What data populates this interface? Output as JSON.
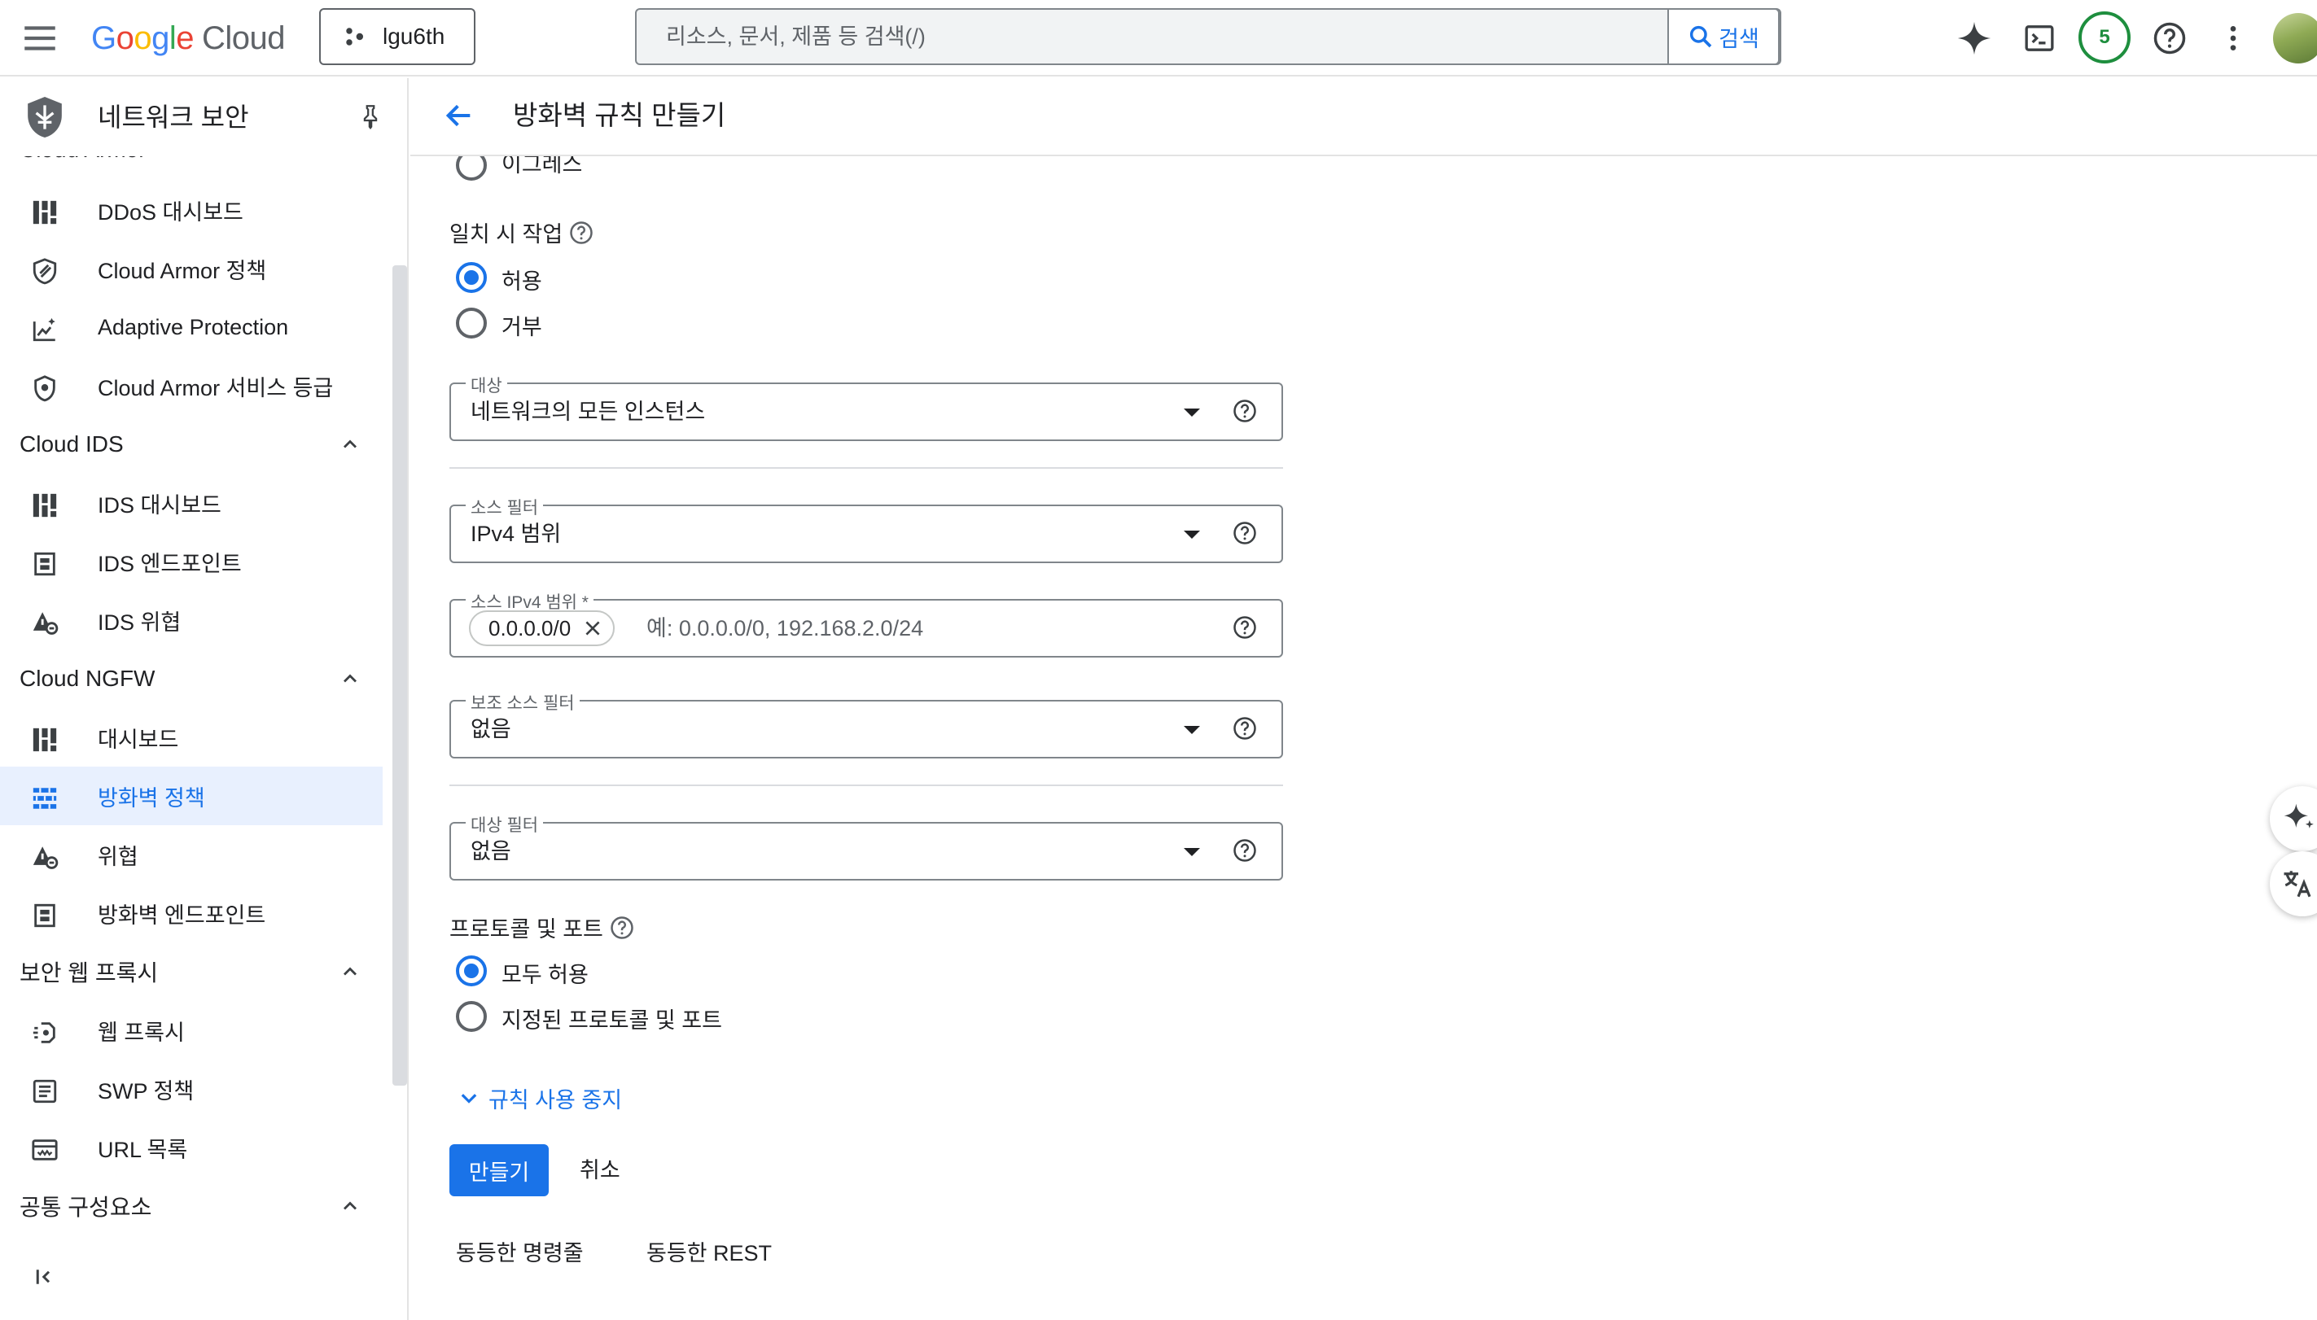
{
  "topbar": {
    "logo_google": "Google",
    "logo_cloud": "Cloud",
    "project": "lgu6th",
    "search_placeholder": "리소스, 문서, 제품 등 검색(/)",
    "search_button": "검색",
    "notification_count": "5",
    "icons": [
      "menu-icon",
      "gemini-icon",
      "cloud-shell-icon",
      "help-icon",
      "more-vert-icon"
    ]
  },
  "sidebar": {
    "title": "네트워크 보안",
    "sections": [
      {
        "title": "Cloud Armor",
        "items": [
          {
            "label": "DDoS 대시보드",
            "icon": "dashboard-icon"
          },
          {
            "label": "Cloud Armor 정책",
            "icon": "shield-icon"
          },
          {
            "label": "Adaptive Protection",
            "icon": "chart-sparkle-icon"
          },
          {
            "label": "Cloud Armor 서비스 등급",
            "icon": "shield-tier-icon"
          }
        ]
      },
      {
        "title": "Cloud IDS",
        "items": [
          {
            "label": "IDS 대시보드",
            "icon": "dashboard-icon"
          },
          {
            "label": "IDS 엔드포인트",
            "icon": "endpoint-icon"
          },
          {
            "label": "IDS 위협",
            "icon": "threat-icon"
          }
        ]
      },
      {
        "title": "Cloud NGFW",
        "items": [
          {
            "label": "대시보드",
            "icon": "dashboard-icon"
          },
          {
            "label": "방화벽 정책",
            "icon": "firewall-icon",
            "active": true
          },
          {
            "label": "위협",
            "icon": "threat-icon"
          },
          {
            "label": "방화벽 엔드포인트",
            "icon": "endpoint-icon"
          }
        ]
      },
      {
        "title": "보안 웹 프록시",
        "items": [
          {
            "label": "웹 프록시",
            "icon": "web-proxy-icon"
          },
          {
            "label": "SWP 정책",
            "icon": "policy-doc-icon"
          },
          {
            "label": "URL 목록",
            "icon": "url-list-icon"
          }
        ]
      },
      {
        "title": "공통 구성요소",
        "items": []
      }
    ]
  },
  "main": {
    "title": "방화벽 규칙 만들기",
    "egress_label": "이그레스",
    "action": {
      "label": "일치 시 작업",
      "options": [
        "허용",
        "거부"
      ],
      "selected": "허용"
    },
    "target": {
      "legend": "대상",
      "value": "네트워크의 모든 인스턴스"
    },
    "source_filter": {
      "legend": "소스 필터",
      "value": "IPv4 범위"
    },
    "source_ipv4": {
      "legend": "소스 IPv4 범위 *",
      "chip": "0.0.0.0/0",
      "placeholder": "예: 0.0.0.0/0, 192.168.2.0/24"
    },
    "secondary_source_filter": {
      "legend": "보조 소스 필터",
      "value": "없음"
    },
    "destination_filter": {
      "legend": "대상 필터",
      "value": "없음"
    },
    "protocols": {
      "label": "프로토콜 및 포트",
      "options": [
        "모두 허용",
        "지정된 프로토콜 및 포트"
      ],
      "selected": "모두 허용"
    },
    "disable_rule_link": "규칙 사용 중지",
    "create_button": "만들기",
    "cancel_button": "취소",
    "equiv_cli": "동등한 명령줄",
    "equiv_rest": "동등한 REST"
  },
  "colors": {
    "accent": "#1a73e8",
    "active_nav_bg": "#e8f0fe",
    "badge_green": "#1e8e3e"
  }
}
